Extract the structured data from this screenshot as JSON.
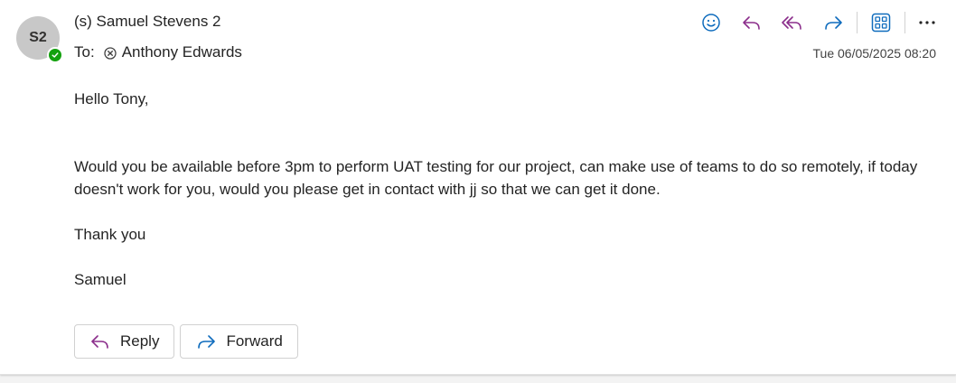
{
  "sender": {
    "initials": "S2",
    "name": "(s) Samuel Stevens 2",
    "presence": "available"
  },
  "recipients": {
    "label": "To:",
    "items": [
      {
        "name": "Anthony Edwards"
      }
    ]
  },
  "date": "Tue 06/05/2025 08:20",
  "toolbar": {
    "icons": [
      "emoji-icon",
      "reply-icon",
      "reply-all-icon",
      "forward-icon",
      "apps-icon",
      "more-icon"
    ],
    "accent_color": "#0f6cbd",
    "reply_color": "#8b2e8b"
  },
  "body": {
    "greeting": "Hello Tony,",
    "paragraph": "Would you be available before 3pm to perform UAT testing for our project, can make use of teams to do so remotely, if today doesn't work for you, would you please get in contact with jj so that we can get it done.",
    "thanks": "Thank you",
    "signature": "Samuel"
  },
  "actions": {
    "reply_label": "Reply",
    "forward_label": "Forward"
  }
}
